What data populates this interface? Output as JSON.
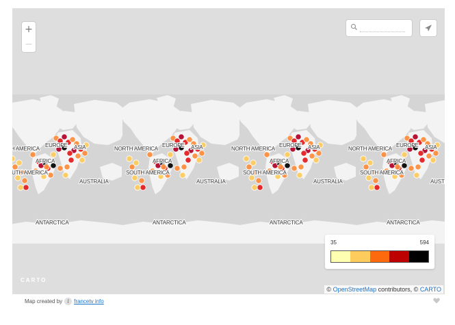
{
  "map": {
    "labels": {
      "north_america": "NORTH AMERICA",
      "south_america": "SOUTH AMERICA",
      "europe": "EUROPE",
      "asia": "ASIA",
      "africa": "AFRICA",
      "australia": "AUSTRALIA",
      "antarctica": "ANTARCTICA"
    },
    "colors": {
      "ocean": "#d7d7d7",
      "land": "#f2f2f2",
      "bubble_scale": [
        "#ffffb2",
        "#fecc5c",
        "#fd8d3c",
        "#e31a1c",
        "#b10026",
        "#000000"
      ]
    }
  },
  "controls": {
    "zoom_in": "+",
    "zoom_out": "—",
    "search_placeholder": "",
    "search_icon": "search-icon",
    "locate_icon": "paper-plane-icon"
  },
  "legend": {
    "min": "35",
    "max": "594",
    "colors": [
      "#ffffb2",
      "#fecc5c",
      "#fd6a0d",
      "#bd0000",
      "#000000"
    ]
  },
  "branding": {
    "carto_logo": "CARTO"
  },
  "attribution": {
    "prefix": "©",
    "osm_link": "OpenStreetMap",
    "contributors": "contributors, ©",
    "carto_link": "CARTO"
  },
  "footer": {
    "created_by": "Map created by",
    "info_glyph": "i",
    "author_link": "francetv info",
    "like_icon": "heart-icon"
  }
}
